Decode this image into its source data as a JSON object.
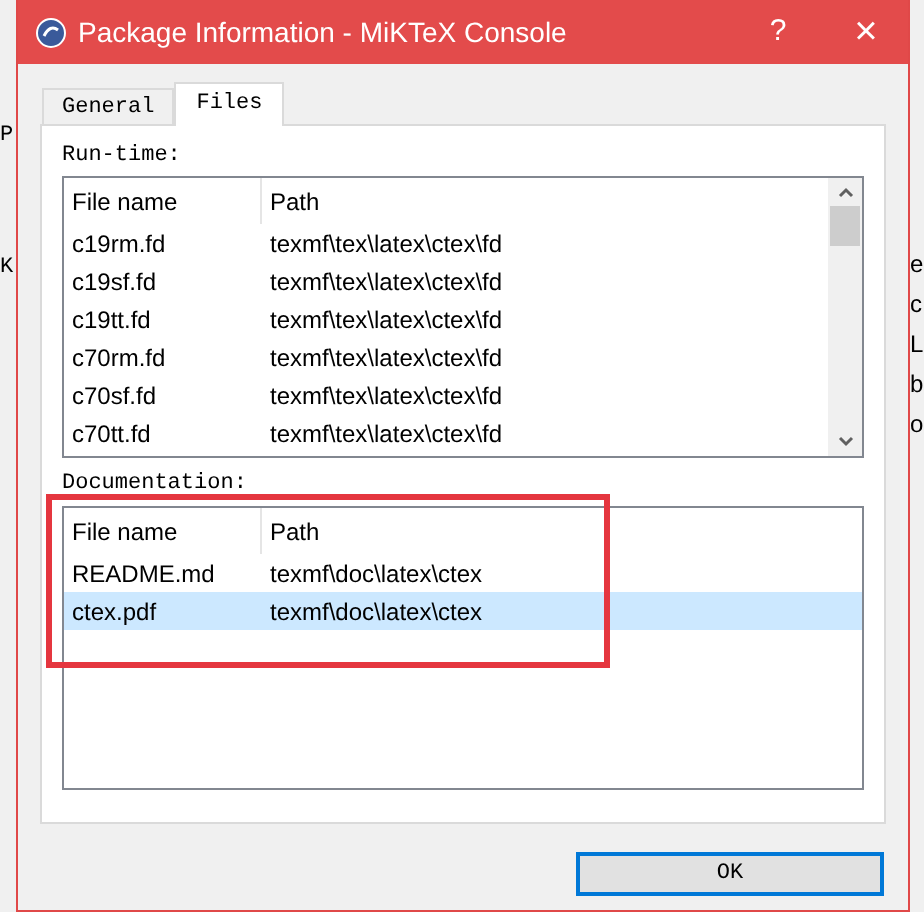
{
  "background_left": [
    "P",
    "K"
  ],
  "background_right": [
    "e",
    "c",
    "L",
    "b",
    "o"
  ],
  "window": {
    "title": "Package Information - MiKTeX Console",
    "help": "?",
    "close": "×"
  },
  "tabs": [
    {
      "label": "General",
      "selected": false
    },
    {
      "label": "Files",
      "selected": true
    }
  ],
  "runtime": {
    "label": "Run-time:",
    "columns": [
      "File name",
      "Path"
    ],
    "rows": [
      {
        "file": "c19rm.fd",
        "path": "texmf\\tex\\latex\\ctex\\fd",
        "selected": false
      },
      {
        "file": "c19sf.fd",
        "path": "texmf\\tex\\latex\\ctex\\fd",
        "selected": false
      },
      {
        "file": "c19tt.fd",
        "path": "texmf\\tex\\latex\\ctex\\fd",
        "selected": false
      },
      {
        "file": "c70rm.fd",
        "path": "texmf\\tex\\latex\\ctex\\fd",
        "selected": false
      },
      {
        "file": "c70sf.fd",
        "path": "texmf\\tex\\latex\\ctex\\fd",
        "selected": false
      },
      {
        "file": "c70tt.fd",
        "path": "texmf\\tex\\latex\\ctex\\fd",
        "selected": false
      }
    ]
  },
  "documentation": {
    "label": "Documentation:",
    "columns": [
      "File name",
      "Path"
    ],
    "rows": [
      {
        "file": "README.md",
        "path": "texmf\\doc\\latex\\ctex",
        "selected": false
      },
      {
        "file": "ctex.pdf",
        "path": "texmf\\doc\\latex\\ctex",
        "selected": true
      }
    ]
  },
  "buttons": [
    "OK"
  ]
}
